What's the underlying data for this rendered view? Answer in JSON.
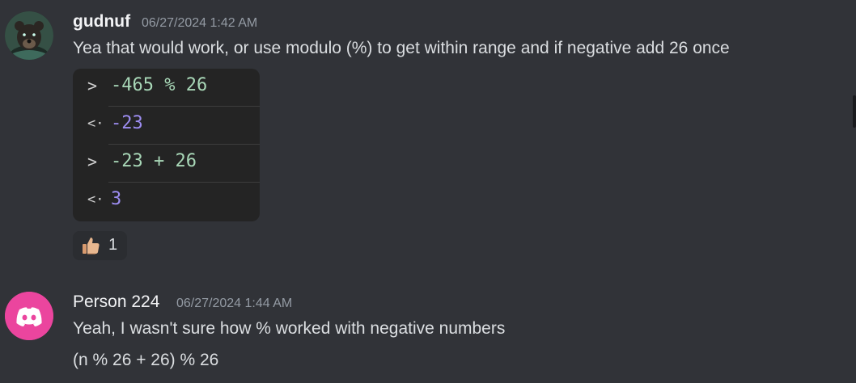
{
  "messages": [
    {
      "author": "gudnuf",
      "timestamp": "06/27/2024 1:42 AM",
      "text": "Yea that would work, or use modulo (%) to get within range and if negative add 26 once",
      "console": {
        "lines": [
          {
            "prompt": ">",
            "code": "-465 % 26"
          },
          {
            "prompt": "<·",
            "code": "-23"
          },
          {
            "prompt": ">",
            "code": "-23 + 26"
          },
          {
            "prompt": "<·",
            "code": "3"
          }
        ]
      },
      "reaction": {
        "icon": "thumbs-up-icon",
        "count": "1"
      }
    },
    {
      "author": "Person 224",
      "timestamp": "06/27/2024 1:44 AM",
      "text": "Yeah, I wasn't sure how % worked with negative numbers",
      "text2": "(n % 26 + 26) % 26"
    }
  ],
  "colors": {
    "background": "#313338",
    "discord_brand": "#eb459e",
    "console_bg": "#242424",
    "number": "#a8d7b7",
    "output": "#9d8df1"
  }
}
